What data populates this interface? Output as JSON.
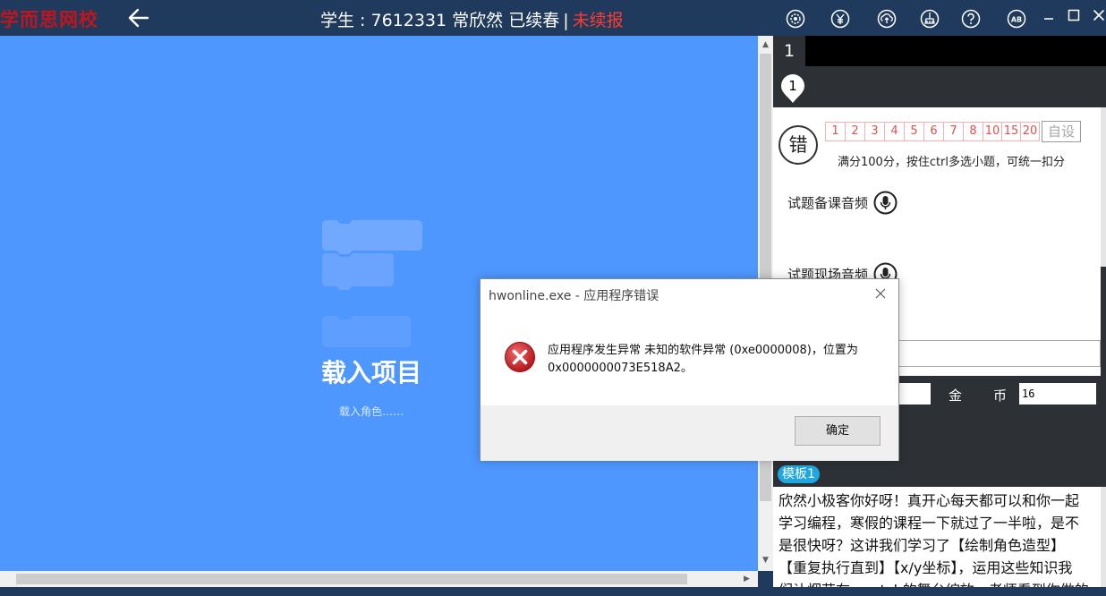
{
  "header": {
    "brand": "学而思网校",
    "student_prefix": "学生 : ",
    "student_id": "7612331",
    "student_name": "常欣然",
    "status_renewed": "已续春",
    "separator": "|",
    "status_not_enrolled": "未续报"
  },
  "stage": {
    "loading_title": "载入项目",
    "loading_subtitle": "载入角色……"
  },
  "panel": {
    "tab_label": "1",
    "pin_label": "1",
    "error_mark": "错",
    "scores": [
      "1",
      "2",
      "3",
      "4",
      "5",
      "6",
      "7",
      "8",
      "10",
      "15",
      "20"
    ],
    "custom_score": "自设",
    "hint": "满分100分，按住ctrl多选小题，可统一扣分",
    "audio_prep_label": "试题备课音频",
    "audio_live_label": "试题现场音频",
    "coin_label_1": "金",
    "coin_label_2": "币",
    "coin_value": "16",
    "template_badge": "模板1",
    "message_lines": [
      "欣然小极客你好呀！真开心每天都可以和你一起",
      "学习编程，寒假的课程一下就过了一半啦，是不",
      "是很快呀？这讲我们学习了【绘制角色造型】",
      "【重复执行直到】【x/y坐标】，运用这些知识我",
      "们让烟花在scratch的舞台绽放，老师看到你做的"
    ]
  },
  "dialog": {
    "title": "hwonline.exe - 应用程序错误",
    "message_line1": "应用程序发生异常 未知的软件异常 (0xe0000008)，位置为",
    "message_line2": "0x0000000073E518A2。",
    "ok_label": "确定"
  },
  "colors": {
    "header_bg": "#1f3a5c",
    "stage_bg": "#4d97ff",
    "brand_red": "#c0151d",
    "warn_red": "#ff3b30",
    "score_red": "#e0504f",
    "badge_blue": "#1fa7e0"
  }
}
